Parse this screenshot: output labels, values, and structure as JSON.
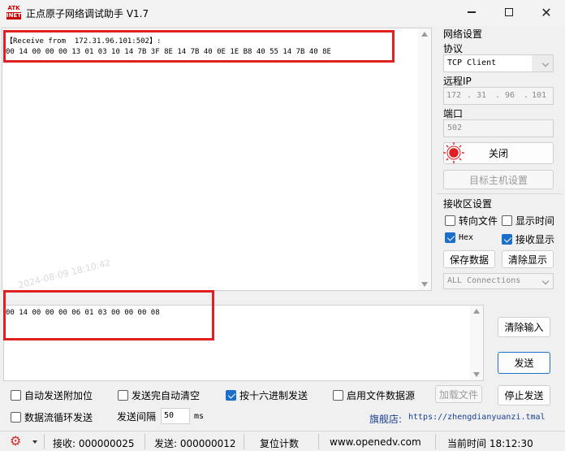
{
  "window": {
    "title": "正点原子网络调试助手 V1.7",
    "logo_line1": "ATK",
    "logo_line2": "INET",
    "minimize_glyph": "—",
    "close_glyph": "✕"
  },
  "receive": {
    "header": "【Receive from  172.31.96.101:502】:",
    "data": "00 14 00 00 00 13 01 03 10 14 7B 3F 8E 14 7B 40 0E 1E B8 40 55 14 7B 40 8E",
    "watermark": "2024-08-09 18:10:42"
  },
  "network": {
    "section_label": "网络设置",
    "protocol_label": "协议",
    "protocol_value": "TCP Client",
    "remote_ip_label": "远程IP",
    "ip_parts": [
      "172",
      "31",
      "96",
      "101"
    ],
    "port_label": "端口",
    "port_value": "502",
    "connect_button": "关闭",
    "target_button": "目标主机设置"
  },
  "receive_settings": {
    "section_label": "接收区设置",
    "to_file": "转向文件",
    "show_time": "显示时间",
    "hex": "Hex",
    "show_receive": "接收显示",
    "save_data": "保存数据",
    "clear_display": "清除显示",
    "connections": "ALL Connections"
  },
  "transmit": {
    "data": "00 14 00 00 00 06 01 03 00 00 00 08",
    "clear_input": "清除输入",
    "send": "发送",
    "stop_send": "停止发送",
    "load_file": "加载文件"
  },
  "options": {
    "auto_append": "自动发送附加位",
    "auto_clear": "发送完自动清空",
    "hex_send": "按十六进制发送",
    "file_source": "启用文件数据源",
    "loop_send": "数据流循环发送",
    "interval_label": "发送间隔",
    "interval_value": "50",
    "interval_unit": "ms",
    "shop_label": "旗舰店:",
    "shop_url": "https://zhengdianyuanzi.tmall.com"
  },
  "status": {
    "receive": "接收: 000000025",
    "send": "发送: 000000012",
    "reset": "复位计数",
    "website": "www.openedv.com",
    "time": "当前时间 18:12:30"
  },
  "colors": {
    "highlight_red": "#e02020",
    "check_blue": "#1a6fc8",
    "link_blue": "#1b3f93"
  }
}
